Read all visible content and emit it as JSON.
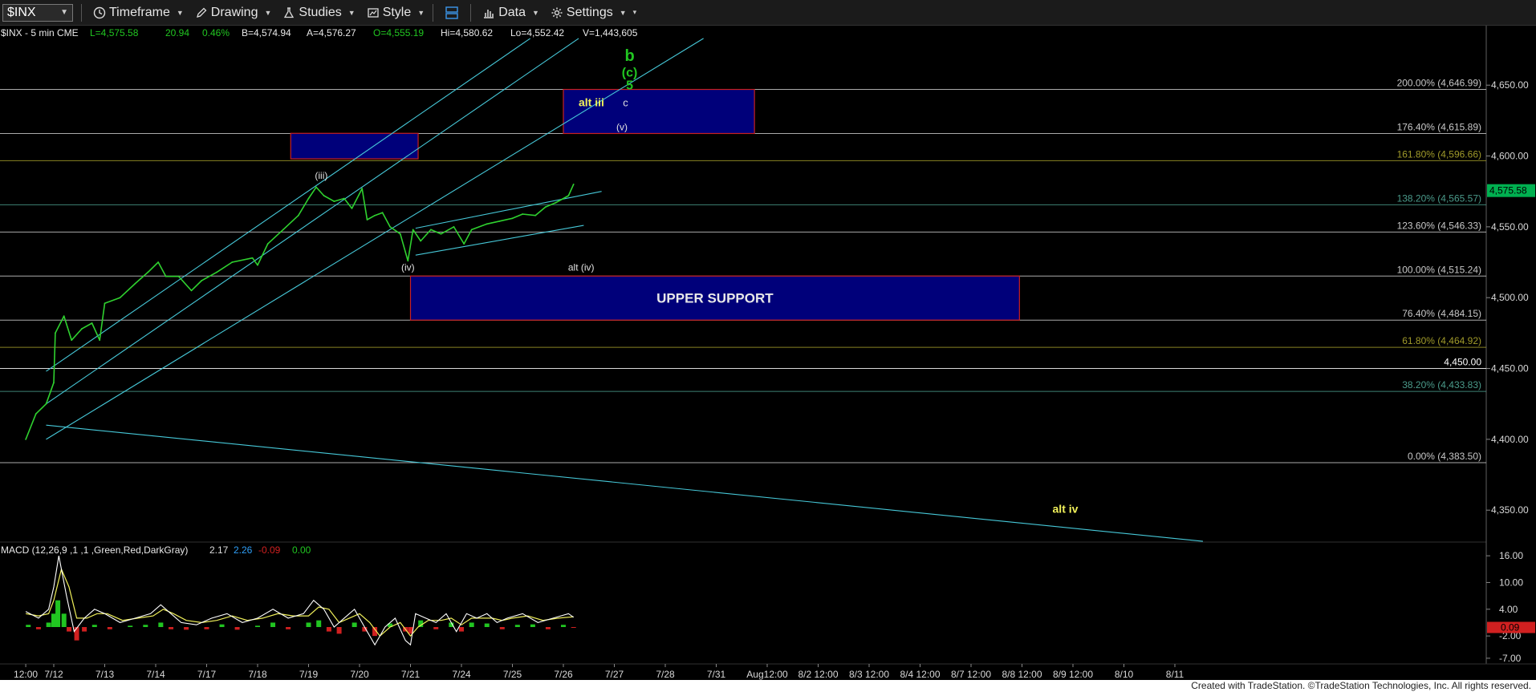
{
  "toolbar": {
    "symbol": "$INX",
    "timeframe": "Timeframe",
    "drawing": "Drawing",
    "studies": "Studies",
    "style": "Style",
    "data": "Data",
    "settings": "Settings"
  },
  "header": {
    "title": "$INX - 5 min  CME",
    "last": "L=4,575.58",
    "change": "20.94",
    "pct": "0.46%",
    "bid": "B=4,574.94",
    "ask": "A=4,576.27",
    "open": "O=4,555.19",
    "high": "Hi=4,580.62",
    "low": "Lo=4,552.42",
    "volume": "V=1,443,605"
  },
  "footer": "Created with TradeStation. ©TradeStation Technologies, Inc. All rights reserved.",
  "chart_data": {
    "type": "line",
    "price_axis": {
      "ylim": [
        4332,
        4692
      ],
      "ticks": [
        "4,650.00",
        "4,600.00",
        "4,550.00",
        "4,500.00",
        "4,450.00",
        "4,400.00",
        "4,350.00"
      ],
      "values": [
        4650,
        4600,
        4550,
        4500,
        4450,
        4400,
        4350
      ]
    },
    "last_price": {
      "value": 4575.58,
      "label": "4,575.58",
      "color": "#00b050"
    },
    "x_axis": {
      "labels": [
        "12:00",
        "7/12",
        "7/13",
        "7/14",
        "7/17",
        "7/18",
        "7/19",
        "7/20",
        "7/21",
        "7/24",
        "7/25",
        "7/26",
        "7/27",
        "7/28",
        "7/31",
        "Aug12:00",
        "8/2 12:00",
        "8/3 12:00",
        "8/4 12:00",
        "8/7 12:00",
        "8/8 12:00",
        "8/9 12:00",
        "8/10",
        "8/11"
      ],
      "index": [
        -0.55,
        0,
        1,
        2,
        3,
        4,
        5,
        6,
        7,
        8,
        9,
        10,
        11,
        12,
        13,
        14,
        15,
        16,
        17,
        18,
        19,
        20,
        21,
        22
      ]
    },
    "fib_levels": [
      {
        "value": 4646.99,
        "label": "200.00% (4,646.99)",
        "color": "#c8c8c8"
      },
      {
        "value": 4615.89,
        "label": "176.40% (4,615.89)",
        "color": "#c8c8c8"
      },
      {
        "value": 4596.66,
        "label": "161.80% (4,596.66)",
        "color": "#a09a2a"
      },
      {
        "value": 4565.57,
        "label": "138.20% (4,565.57)",
        "color": "#4a9a8a"
      },
      {
        "value": 4546.33,
        "label": "123.60% (4,546.33)",
        "color": "#c8c8c8"
      },
      {
        "value": 4515.24,
        "label": "100.00% (4,515.24)",
        "color": "#c8c8c8"
      },
      {
        "value": 4484.15,
        "label": "76.40% (4,484.15)",
        "color": "#c8c8c8"
      },
      {
        "value": 4464.92,
        "label": "61.80% (4,464.92)",
        "color": "#a09a2a"
      },
      {
        "value": 4450.0,
        "label": "4,450.00",
        "color": "#ffffff"
      },
      {
        "value": 4433.83,
        "label": "38.20% (4,433.83)",
        "color": "#4a9a8a"
      },
      {
        "value": 4383.5,
        "label": "0.00% (4,383.50)",
        "color": "#c8c8c8"
      }
    ],
    "zones": [
      {
        "name": "upper-support",
        "label": "UPPER SUPPORT",
        "x": [
          7,
          18.95
        ],
        "y": [
          4484.15,
          4515.24
        ]
      },
      {
        "name": "target-box-left",
        "label": "",
        "x": [
          4.65,
          7.15
        ],
        "y": [
          4598,
          4616
        ]
      },
      {
        "name": "target-box-right",
        "label": "",
        "x": [
          10,
          13.75
        ],
        "y": [
          4615.89,
          4646.99
        ]
      }
    ],
    "channel_lines": [
      {
        "from": [
          -0.15,
          4448
        ],
        "to": [
          9.35,
          4683
        ]
      },
      {
        "from": [
          -0.15,
          4425
        ],
        "to": [
          10.3,
          4683
        ]
      },
      {
        "from": [
          -0.15,
          4400
        ],
        "to": [
          12.75,
          4683
        ]
      },
      {
        "from": [
          7.1,
          4549
        ],
        "to": [
          10.75,
          4575
        ]
      },
      {
        "from": [
          7.1,
          4530
        ],
        "to": [
          10.4,
          4551
        ]
      },
      {
        "from": [
          -0.15,
          4410
        ],
        "to": [
          22.55,
          4328
        ]
      }
    ],
    "wave_labels": [
      {
        "text": "b",
        "x": 11.3,
        "y": 4667,
        "color": "#21c521",
        "size": 20,
        "bold": true
      },
      {
        "text": "(c)",
        "x": 11.3,
        "y": 4656,
        "color": "#21c521",
        "size": 16,
        "bold": true
      },
      {
        "text": "5",
        "x": 11.3,
        "y": 4647,
        "color": "#21c521",
        "size": 16,
        "bold": true
      },
      {
        "text": "alt iii",
        "x": 10.55,
        "y": 4635,
        "color": "#f0f05a",
        "size": 14,
        "bold": true
      },
      {
        "text": "c",
        "x": 11.22,
        "y": 4635,
        "color": "#e0e0e0",
        "size": 13,
        "bold": false
      },
      {
        "text": "(v)",
        "x": 11.15,
        "y": 4618,
        "color": "#e0e0e0",
        "size": 12,
        "bold": false
      },
      {
        "text": "(iii)",
        "x": 5.25,
        "y": 4584,
        "color": "#e0e0e0",
        "size": 12,
        "bold": false
      },
      {
        "text": "(iv)",
        "x": 6.95,
        "y": 4519,
        "color": "#e0e0e0",
        "size": 12,
        "bold": false
      },
      {
        "text": "alt (iv)",
        "x": 10.35,
        "y": 4519,
        "color": "#e0e0e0",
        "size": 12,
        "bold": false
      },
      {
        "text": "alt iv",
        "x": 19.85,
        "y": 4348,
        "color": "#f0f05a",
        "size": 14,
        "bold": true
      }
    ],
    "series": [
      {
        "name": "$INX",
        "color": "#2fd12f",
        "points": [
          [
            -0.55,
            4400
          ],
          [
            -0.35,
            4418
          ],
          [
            -0.15,
            4425
          ],
          [
            0.0,
            4440
          ],
          [
            0.03,
            4475
          ],
          [
            0.2,
            4487
          ],
          [
            0.35,
            4470
          ],
          [
            0.55,
            4478
          ],
          [
            0.75,
            4482
          ],
          [
            0.9,
            4470
          ],
          [
            1.0,
            4496
          ],
          [
            1.3,
            4500
          ],
          [
            1.6,
            4510
          ],
          [
            1.85,
            4518
          ],
          [
            2.05,
            4525
          ],
          [
            2.2,
            4515
          ],
          [
            2.45,
            4515
          ],
          [
            2.7,
            4505
          ],
          [
            2.9,
            4512
          ],
          [
            3.2,
            4518
          ],
          [
            3.5,
            4525
          ],
          [
            3.9,
            4528
          ],
          [
            4.0,
            4523
          ],
          [
            4.2,
            4538
          ],
          [
            4.5,
            4548
          ],
          [
            4.8,
            4558
          ],
          [
            5.0,
            4570
          ],
          [
            5.15,
            4578
          ],
          [
            5.3,
            4572
          ],
          [
            5.5,
            4568
          ],
          [
            5.7,
            4570
          ],
          [
            5.85,
            4563
          ],
          [
            6.05,
            4577
          ],
          [
            6.15,
            4555
          ],
          [
            6.3,
            4558
          ],
          [
            6.45,
            4560
          ],
          [
            6.6,
            4550
          ],
          [
            6.8,
            4545
          ],
          [
            6.95,
            4526
          ],
          [
            7.05,
            4548
          ],
          [
            7.2,
            4540
          ],
          [
            7.4,
            4548
          ],
          [
            7.6,
            4545
          ],
          [
            7.85,
            4550
          ],
          [
            8.05,
            4538
          ],
          [
            8.2,
            4548
          ],
          [
            8.5,
            4552
          ],
          [
            8.75,
            4554
          ],
          [
            9.0,
            4556
          ],
          [
            9.2,
            4559
          ],
          [
            9.45,
            4558
          ],
          [
            9.65,
            4564
          ],
          [
            9.85,
            4567
          ],
          [
            10.1,
            4572
          ],
          [
            10.2,
            4580
          ]
        ]
      }
    ],
    "macd": {
      "label": "MACD (12,26,9 ,1 ,1 ,Green,Red,DarkGray)",
      "values_text": [
        "2.17",
        "2.26",
        "-0.09",
        "0.00"
      ],
      "value_colors": [
        "#dddddd",
        "#2f9ff7",
        "#d02020",
        "#21c521"
      ],
      "ylim": [
        -7.2,
        18
      ],
      "ticks": [
        "16.00",
        "10.00",
        "4.00",
        "-2.00",
        "-7.00"
      ],
      "tick_values": [
        16,
        10,
        4,
        -2,
        -7
      ],
      "last_badges": [
        {
          "text": "0.09",
          "value": -0.09,
          "color": "#d02020"
        }
      ],
      "macd_line": [
        [
          -0.55,
          3.5
        ],
        [
          -0.3,
          2
        ],
        [
          -0.1,
          4
        ],
        [
          0.0,
          9
        ],
        [
          0.1,
          16
        ],
        [
          0.25,
          7
        ],
        [
          0.4,
          -1
        ],
        [
          0.6,
          2
        ],
        [
          0.8,
          4
        ],
        [
          1.0,
          3
        ],
        [
          1.3,
          1
        ],
        [
          1.6,
          2
        ],
        [
          1.9,
          3
        ],
        [
          2.1,
          5
        ],
        [
          2.3,
          3
        ],
        [
          2.5,
          1
        ],
        [
          2.8,
          0.5
        ],
        [
          3.1,
          2
        ],
        [
          3.4,
          3
        ],
        [
          3.7,
          1
        ],
        [
          4.0,
          2
        ],
        [
          4.3,
          4
        ],
        [
          4.6,
          2
        ],
        [
          4.9,
          3
        ],
        [
          5.1,
          6
        ],
        [
          5.3,
          4
        ],
        [
          5.5,
          0
        ],
        [
          5.7,
          2
        ],
        [
          5.9,
          4
        ],
        [
          6.1,
          0
        ],
        [
          6.3,
          -4
        ],
        [
          6.5,
          0
        ],
        [
          6.7,
          2
        ],
        [
          6.9,
          -3
        ],
        [
          7.0,
          -4
        ],
        [
          7.1,
          3
        ],
        [
          7.3,
          2
        ],
        [
          7.5,
          1
        ],
        [
          7.7,
          3
        ],
        [
          7.9,
          -1
        ],
        [
          8.1,
          3
        ],
        [
          8.3,
          2
        ],
        [
          8.5,
          3
        ],
        [
          8.7,
          1
        ],
        [
          8.9,
          2
        ],
        [
          9.2,
          3
        ],
        [
          9.5,
          1
        ],
        [
          9.8,
          2
        ],
        [
          10.1,
          3
        ],
        [
          10.2,
          2.2
        ]
      ],
      "signal_line": [
        [
          -0.55,
          3
        ],
        [
          -0.3,
          2.5
        ],
        [
          -0.1,
          3
        ],
        [
          0.0,
          6
        ],
        [
          0.15,
          13
        ],
        [
          0.3,
          9
        ],
        [
          0.45,
          2
        ],
        [
          0.65,
          2
        ],
        [
          0.85,
          3
        ],
        [
          1.05,
          3
        ],
        [
          1.35,
          1.5
        ],
        [
          1.65,
          2
        ],
        [
          1.95,
          2.5
        ],
        [
          2.15,
          4
        ],
        [
          2.35,
          3
        ],
        [
          2.6,
          1.5
        ],
        [
          2.9,
          1
        ],
        [
          3.2,
          1.5
        ],
        [
          3.5,
          2.5
        ],
        [
          3.8,
          1.5
        ],
        [
          4.1,
          2
        ],
        [
          4.4,
          3
        ],
        [
          4.7,
          2.5
        ],
        [
          5.0,
          2.5
        ],
        [
          5.2,
          4.5
        ],
        [
          5.4,
          4
        ],
        [
          5.6,
          1
        ],
        [
          5.8,
          2
        ],
        [
          6.0,
          3
        ],
        [
          6.2,
          1
        ],
        [
          6.4,
          -2
        ],
        [
          6.6,
          0
        ],
        [
          6.8,
          1
        ],
        [
          7.0,
          -2
        ],
        [
          7.15,
          0
        ],
        [
          7.35,
          1.5
        ],
        [
          7.6,
          1.5
        ],
        [
          7.8,
          2
        ],
        [
          8.0,
          0.5
        ],
        [
          8.2,
          2
        ],
        [
          8.4,
          2
        ],
        [
          8.6,
          2
        ],
        [
          8.8,
          1.5
        ],
        [
          9.0,
          2
        ],
        [
          9.3,
          2.5
        ],
        [
          9.6,
          1.5
        ],
        [
          9.9,
          2
        ],
        [
          10.2,
          2.3
        ]
      ],
      "histogram": [
        [
          -0.5,
          0.5
        ],
        [
          -0.3,
          -0.5
        ],
        [
          -0.1,
          1
        ],
        [
          0.0,
          3
        ],
        [
          0.08,
          6
        ],
        [
          0.2,
          3
        ],
        [
          0.3,
          -1
        ],
        [
          0.45,
          -3
        ],
        [
          0.6,
          -1
        ],
        [
          0.8,
          0.5
        ],
        [
          1.1,
          -0.5
        ],
        [
          1.5,
          0.3
        ],
        [
          1.8,
          0.5
        ],
        [
          2.1,
          1
        ],
        [
          2.3,
          -0.5
        ],
        [
          2.6,
          -0.6
        ],
        [
          3.0,
          -0.5
        ],
        [
          3.3,
          0.6
        ],
        [
          3.6,
          -0.6
        ],
        [
          4.0,
          0.3
        ],
        [
          4.3,
          1
        ],
        [
          4.6,
          -0.5
        ],
        [
          5.0,
          1
        ],
        [
          5.2,
          1.5
        ],
        [
          5.4,
          -1
        ],
        [
          5.6,
          -1.5
        ],
        [
          5.9,
          1
        ],
        [
          6.1,
          -1
        ],
        [
          6.3,
          -2
        ],
        [
          6.6,
          0.8
        ],
        [
          6.9,
          -1
        ],
        [
          7.0,
          -1.5
        ],
        [
          7.2,
          1.5
        ],
        [
          7.5,
          -0.5
        ],
        [
          7.8,
          1
        ],
        [
          8.0,
          -1
        ],
        [
          8.2,
          1
        ],
        [
          8.5,
          0.8
        ],
        [
          8.8,
          -0.5
        ],
        [
          9.1,
          0.5
        ],
        [
          9.4,
          0.6
        ],
        [
          9.7,
          -0.5
        ],
        [
          10.0,
          0.5
        ],
        [
          10.2,
          -0.1
        ]
      ]
    }
  }
}
